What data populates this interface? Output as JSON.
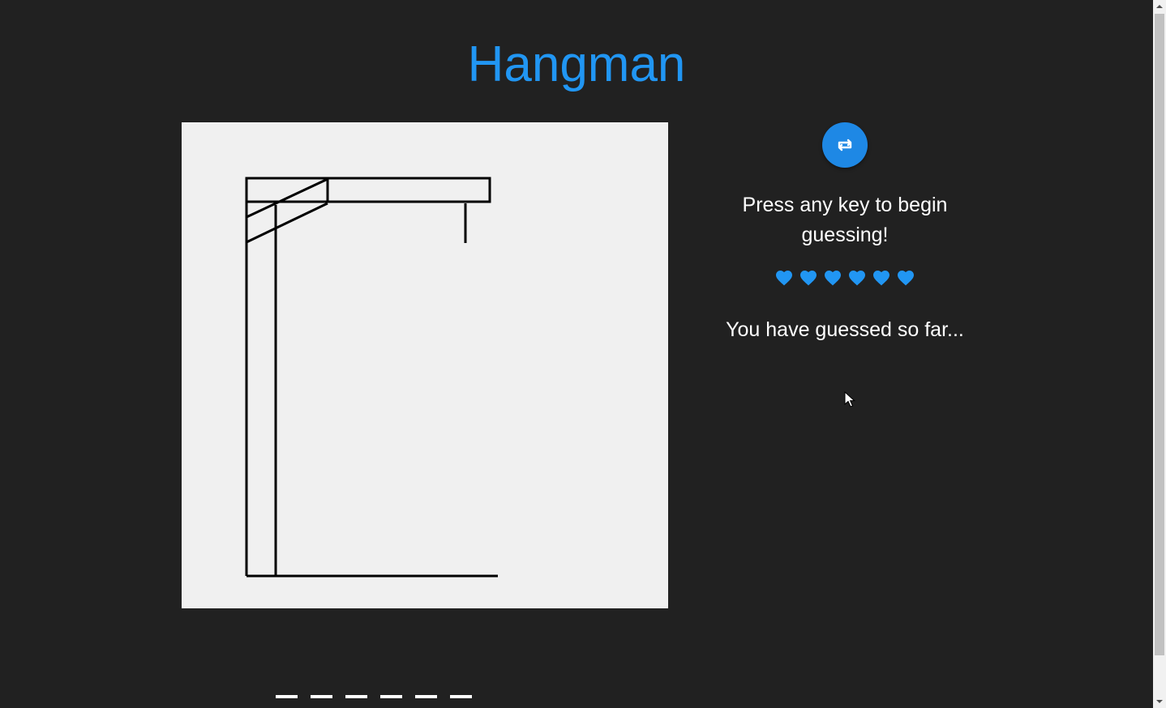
{
  "title": "Hangman",
  "restart_button": {
    "icon": "repeat-icon"
  },
  "status": {
    "prompt": "Press any key to begin guessing!"
  },
  "lives": {
    "count": 6,
    "max": 6,
    "icon": "heart-icon",
    "color": "#2196f3"
  },
  "guessed": {
    "label": "You have guessed so far...",
    "letters": ""
  },
  "word": {
    "blanks": [
      "",
      "",
      "",
      "",
      "",
      ""
    ]
  },
  "colors": {
    "accent": "#2196f3",
    "background": "#212121",
    "board": "#f0f0f0",
    "button": "#1e88e5"
  }
}
